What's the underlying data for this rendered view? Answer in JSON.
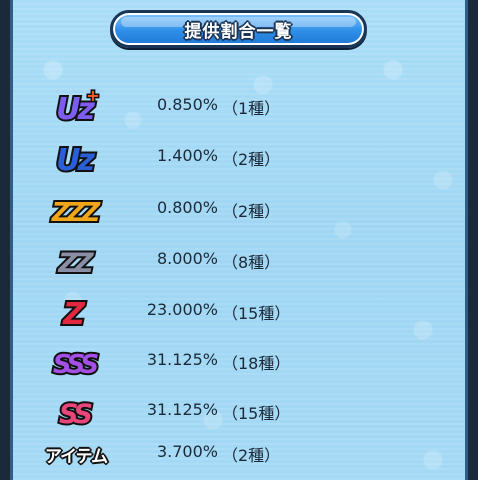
{
  "title": "提供割合一覧",
  "rows": [
    {
      "rank": "UZ+",
      "rate": "0.850%",
      "count": "（1種）",
      "fill": "#5a3dbd",
      "icon": "uz-plus-rank-icon"
    },
    {
      "rank": "UZ",
      "rate": "1.400%",
      "count": "（2種）",
      "fill": "#2b5fd8",
      "icon": "uz-rank-icon"
    },
    {
      "rank": "ZZZ",
      "rate": "0.800%",
      "count": "（2種）",
      "fill": "#f0a61a",
      "icon": "zzz-rank-icon"
    },
    {
      "rank": "ZZ",
      "rate": "8.000%",
      "count": "（8種）",
      "fill": "#8b8fa6",
      "icon": "zz-rank-icon"
    },
    {
      "rank": "Z",
      "rate": "23.000%",
      "count": "（15種）",
      "fill": "#e2283f",
      "icon": "z-rank-icon"
    },
    {
      "rank": "SSS",
      "rate": "31.125%",
      "count": "（18種）",
      "fill": "#a64fe6",
      "icon": "sss-rank-icon"
    },
    {
      "rank": "SS",
      "rate": "31.125%",
      "count": "（15種）",
      "fill": "#e8457b",
      "icon": "ss-rank-icon"
    },
    {
      "rank": "アイテム",
      "rate": "3.700%",
      "count": "（2種）",
      "fill": "#ffffff",
      "icon": "item-rank-icon"
    }
  ]
}
